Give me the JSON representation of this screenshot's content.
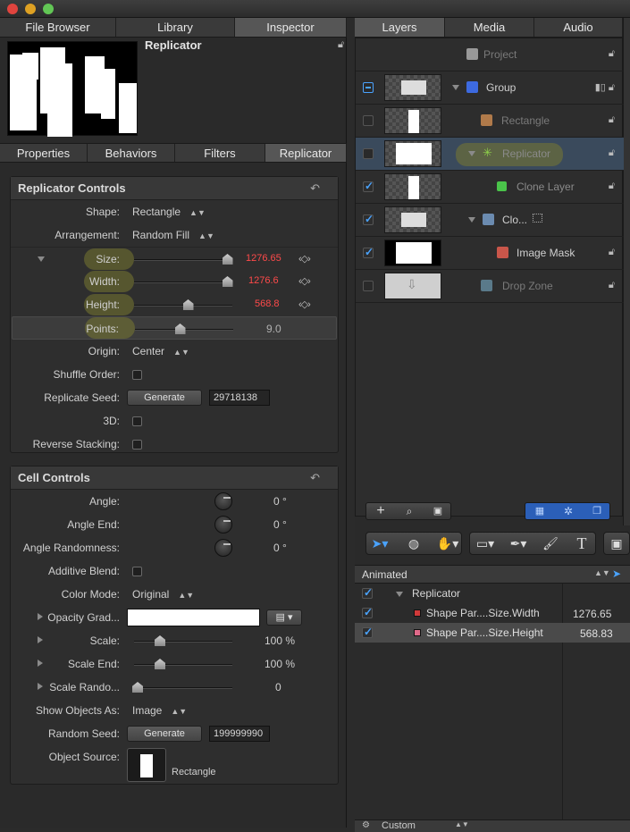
{
  "inspector_tabs": [
    "File Browser",
    "Library",
    "Inspector"
  ],
  "selected_object_title": "Replicator",
  "sub_tabs": [
    "Properties",
    "Behaviors",
    "Filters",
    "Replicator"
  ],
  "replicator_controls": {
    "title": "Replicator Controls",
    "shape_label": "Shape:",
    "shape_value": "Rectangle",
    "arrangement_label": "Arrangement:",
    "arrangement_value": "Random Fill",
    "size_label": "Size:",
    "size_value": "1276.65",
    "size_fraction": 0.95,
    "width_label": "Width:",
    "width_value": "1276.6",
    "width_fraction": 0.95,
    "height_label": "Height:",
    "height_value": "568.8",
    "height_fraction": 0.55,
    "points_label": "Points:",
    "points_value": "9.0",
    "points_fraction": 0.45,
    "origin_label": "Origin:",
    "origin_value": "Center",
    "shuffle_label": "Shuffle Order:",
    "seed_label": "Replicate Seed:",
    "generate_label": "Generate",
    "seed_value": "29718138",
    "threed_label": "3D:",
    "reverse_label": "Reverse Stacking:"
  },
  "cell_controls": {
    "title": "Cell Controls",
    "angle_label": "Angle:",
    "angle_value": "0 °",
    "angle_end_label": "Angle End:",
    "angle_end_value": "0 °",
    "angle_rand_label": "Angle Randomness:",
    "angle_rand_value": "0 °",
    "additive_label": "Additive Blend:",
    "color_mode_label": "Color Mode:",
    "color_mode_value": "Original",
    "opacity_label": "Opacity Grad...",
    "scale_label": "Scale:",
    "scale_value": "100 %",
    "scale_end_label": "Scale End:",
    "scale_end_value": "100 %",
    "scale_rand_label": "Scale Rando...",
    "scale_rand_value": "0",
    "show_as_label": "Show Objects As:",
    "show_as_value": "Image",
    "random_seed_label": "Random Seed:",
    "generate_label": "Generate",
    "random_seed_value": "199999990",
    "object_source_label": "Object Source:",
    "object_source_value": "Rectangle"
  },
  "right_tabs": [
    "Layers",
    "Media",
    "Audio"
  ],
  "layers": [
    {
      "name": "Project"
    },
    {
      "name": "Group"
    },
    {
      "name": "Rectangle"
    },
    {
      "name": "Replicator"
    },
    {
      "name": "Clone Layer"
    },
    {
      "name": "Clo..."
    },
    {
      "name": "Image Mask"
    },
    {
      "name": "Drop Zone"
    }
  ],
  "timeline": {
    "dropdown": "Animated",
    "rows": [
      {
        "name": "Replicator",
        "value": ""
      },
      {
        "name": "Shape Par....Size.Width",
        "value": "1276.65"
      },
      {
        "name": "Shape Par....Size.Height",
        "value": "568.83"
      }
    ],
    "footer_dropdown": "Custom"
  },
  "colors": {
    "accent": "#4aa3ff",
    "keyframed_value": "#ff4a4a",
    "highlight": "#78783a"
  }
}
